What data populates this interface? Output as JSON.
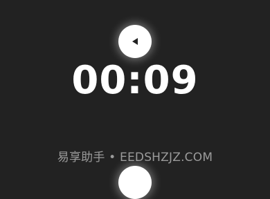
{
  "timer": {
    "display": "00:09"
  },
  "controls": {
    "top_button_icon": "play-left-triangle-icon",
    "bottom_button_icon": "circle-button-icon"
  },
  "watermark": {
    "text": "易享助手 • EEDSHZJZ.COM"
  },
  "colors": {
    "background": "#222222",
    "text": "#ffffff",
    "button": "#ffffff",
    "watermark": "#9b9b9b"
  }
}
